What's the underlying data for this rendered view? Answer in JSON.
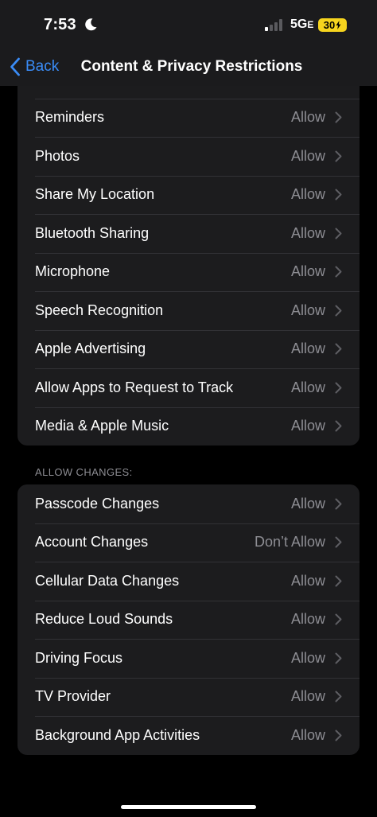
{
  "status_bar": {
    "time": "7:53",
    "network": "5G",
    "network_suffix": "E",
    "battery": "30"
  },
  "nav": {
    "back_label": "Back",
    "title": "Content & Privacy Restrictions"
  },
  "privacy_group": {
    "rows": [
      {
        "label": "Reminders",
        "value": "Allow"
      },
      {
        "label": "Photos",
        "value": "Allow"
      },
      {
        "label": "Share My Location",
        "value": "Allow"
      },
      {
        "label": "Bluetooth Sharing",
        "value": "Allow"
      },
      {
        "label": "Microphone",
        "value": "Allow"
      },
      {
        "label": "Speech Recognition",
        "value": "Allow"
      },
      {
        "label": "Apple Advertising",
        "value": "Allow"
      },
      {
        "label": "Allow Apps to Request to Track",
        "value": "Allow"
      },
      {
        "label": "Media & Apple Music",
        "value": "Allow"
      }
    ]
  },
  "changes_section": {
    "header": "ALLOW CHANGES:",
    "rows": [
      {
        "label": "Passcode Changes",
        "value": "Allow"
      },
      {
        "label": "Account Changes",
        "value": "Don’t Allow"
      },
      {
        "label": "Cellular Data Changes",
        "value": "Allow"
      },
      {
        "label": "Reduce Loud Sounds",
        "value": "Allow"
      },
      {
        "label": "Driving Focus",
        "value": "Allow"
      },
      {
        "label": "TV Provider",
        "value": "Allow"
      },
      {
        "label": "Background App Activities",
        "value": "Allow"
      }
    ]
  },
  "colors": {
    "accent": "#3a8cf7",
    "battery": "#f6d41e",
    "secondary_text": "#8d8d93",
    "cell_background": "#1c1c1e"
  }
}
